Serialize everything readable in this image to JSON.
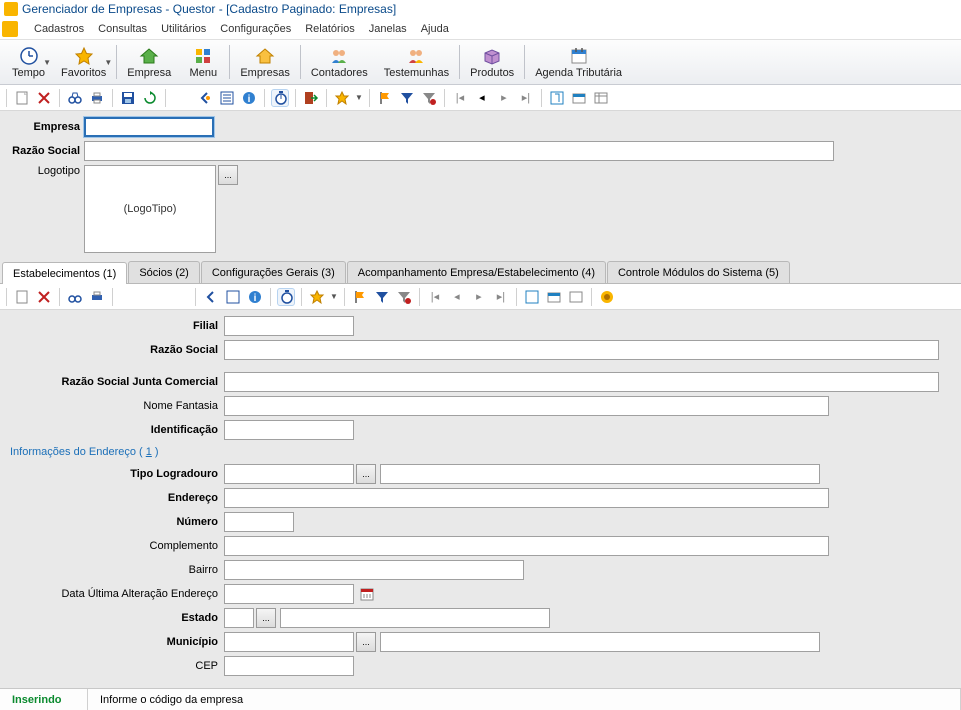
{
  "title": "Gerenciador de Empresas - Questor - [Cadastro Paginado: Empresas]",
  "menubar": [
    "Cadastros",
    "Consultas",
    "Utilitários",
    "Configurações",
    "Relatórios",
    "Janelas",
    "Ajuda"
  ],
  "big_toolbar": [
    {
      "label": "Tempo",
      "icon": "clock",
      "caret": true
    },
    {
      "label": "Favoritos",
      "icon": "star",
      "caret": true
    },
    {
      "sep": true
    },
    {
      "label": "Empresa",
      "icon": "home-green"
    },
    {
      "label": "Menu",
      "icon": "grid"
    },
    {
      "sep": true
    },
    {
      "label": "Empresas",
      "icon": "home-yellow"
    },
    {
      "sep": true
    },
    {
      "label": "Contadores",
      "icon": "people"
    },
    {
      "label": "Testemunhas",
      "icon": "people2"
    },
    {
      "sep": true
    },
    {
      "label": "Produtos",
      "icon": "box"
    },
    {
      "sep": true
    },
    {
      "label": "Agenda Tributária",
      "icon": "calendar"
    }
  ],
  "form": {
    "empresa_label": "Empresa",
    "razao_label": "Razão Social",
    "logotipo_label": "Logotipo",
    "logotipo_placeholder": "(LogoTipo)"
  },
  "tabs": [
    "Estabelecimentos (1)",
    "Sócios (2)",
    "Configurações Gerais (3)",
    "Acompanhamento Empresa/Estabelecimento (4)",
    "Controle Módulos do Sistema (5)"
  ],
  "detail": {
    "filial": "Filial",
    "razao": "Razão Social",
    "razao_junta": "Razão Social Junta Comercial",
    "nome_fantasia": "Nome Fantasia",
    "identificacao": "Identificação",
    "section": "Informações do Endereço ( ",
    "section_link": "1",
    "section_close": " )",
    "tipo_log": "Tipo Logradouro",
    "endereco": "Endereço",
    "numero": "Número",
    "complemento": "Complemento",
    "bairro": "Bairro",
    "data_ult": "Data Última Alteração Endereço",
    "estado": "Estado",
    "municipio": "Município",
    "cep": "CEP"
  },
  "status": {
    "mode": "Inserindo",
    "hint": "Informe o código da empresa"
  }
}
